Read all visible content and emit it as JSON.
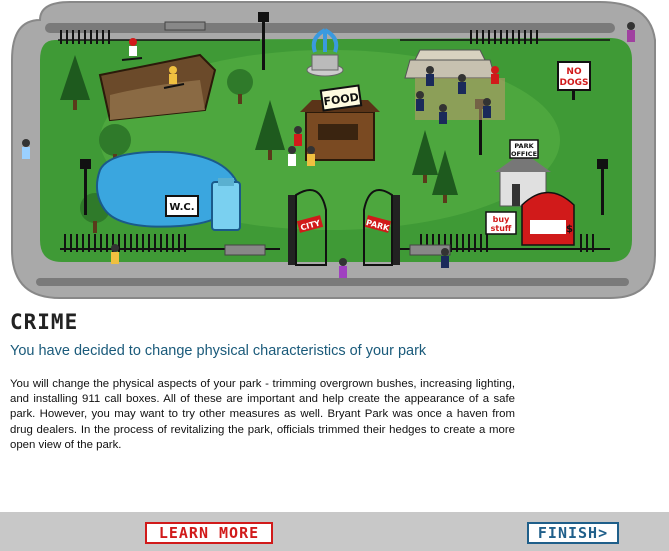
{
  "scene": {
    "signs": {
      "food": "FOOD",
      "no_dogs_line1": "NO",
      "no_dogs_line2": "DOGS",
      "wc": "W.C.",
      "park_office_line1": "PARK",
      "park_office_line2": "OFFICE",
      "buy_stuff_line1": "buy",
      "buy_stuff_line2": "stuff",
      "gate_left": "CITY",
      "gate_right": "PARK",
      "booth_symbol": "$"
    }
  },
  "content": {
    "title": "CRIME",
    "subtitle": "You have decided to change physical characteristics of your park",
    "body": "You will change the physical aspects of your park - trimming overgrown bushes, increasing lighting, and installing 911 call boxes. All of these are important and help create the appearance of a safe park. However, you may want to try other measures as well. Bryant Park was once a haven from drug dealers. In the process of revitalizing the park, officials trimmed their hedges to create a more open view of the park."
  },
  "footer": {
    "learn_more_label": "LEARN MORE",
    "finish_label": "FINISH>"
  },
  "colors": {
    "accent_red": "#d11a1a",
    "accent_blue": "#1f5f8a",
    "subtitle_teal": "#1a5a7a",
    "grass": "#3f9a36",
    "footer_gray": "#c8c8c8"
  }
}
